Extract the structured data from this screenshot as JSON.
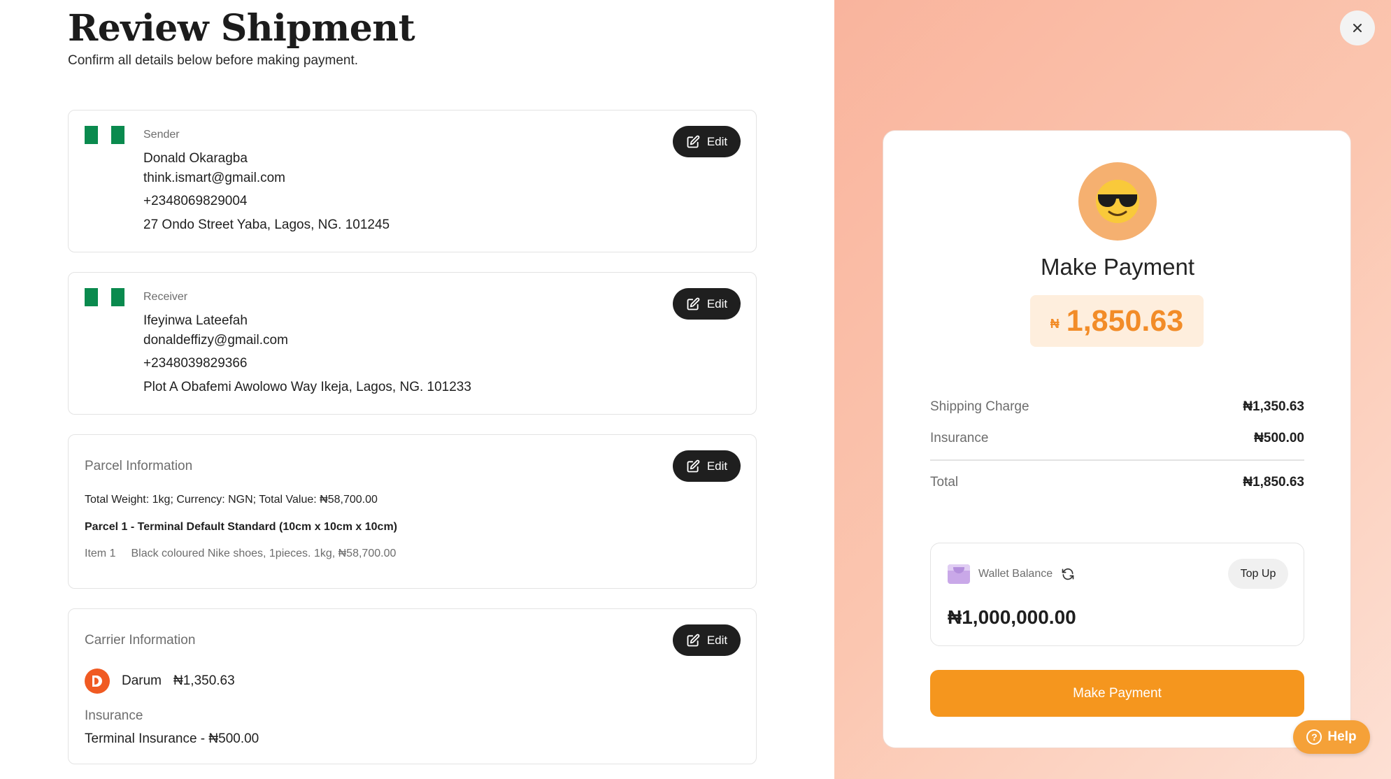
{
  "header": {
    "title": "Review Shipment",
    "subtitle": "Confirm all details below before making payment."
  },
  "sender": {
    "label": "Sender",
    "name": "Donald Okaragba",
    "email": "think.ismart@gmail.com",
    "phone": "+2348069829004",
    "address": "27 Ondo Street Yaba, Lagos, NG. 101245",
    "edit_label": "Edit"
  },
  "receiver": {
    "label": "Receiver",
    "name": "Ifeyinwa Lateefah",
    "email": "donaldeffizy@gmail.com",
    "phone": "+2348039829366",
    "address": "Plot A Obafemi Awolowo Way Ikeja, Lagos, NG. 101233",
    "edit_label": "Edit"
  },
  "parcel": {
    "title": "Parcel Information",
    "summary": "Total Weight: 1kg; Currency: NGN; Total Value: ₦58,700.00",
    "parcel_name": "Parcel 1 - Terminal Default Standard (10cm x 10cm x 10cm)",
    "item_label": "Item 1",
    "item_desc": "Black coloured Nike shoes, 1pieces. 1kg, ₦58,700.00",
    "edit_label": "Edit"
  },
  "carrier": {
    "title": "Carrier Information",
    "name": "Darum",
    "price": "₦1,350.63",
    "insurance_label": "Insurance",
    "insurance_value": "Terminal Insurance - ₦500.00",
    "edit_label": "Edit"
  },
  "payment": {
    "title": "Make Payment",
    "currency_symbol": "₦",
    "amount": "1,850.63",
    "fees": [
      {
        "label": "Shipping Charge",
        "value": "₦1,350.63"
      },
      {
        "label": "Insurance",
        "value": "₦500.00"
      }
    ],
    "total_label": "Total",
    "total_value": "₦1,850.63",
    "wallet_label": "Wallet Balance",
    "wallet_balance": "₦1,000,000.00",
    "topup_label": "Top Up",
    "button_label": "Make Payment"
  },
  "help": {
    "label": "Help"
  },
  "colors": {
    "accent": "#f5961e",
    "flag_green": "#0a8a4e",
    "panel_bg": "#f9b49d",
    "dark_button": "#1f1f1f"
  },
  "icons": {
    "edit": "edit-icon",
    "close": "close-icon",
    "emoji": "sunglasses-emoji-icon",
    "wallet": "wallet-icon",
    "refresh": "refresh-icon",
    "help": "help-icon"
  }
}
